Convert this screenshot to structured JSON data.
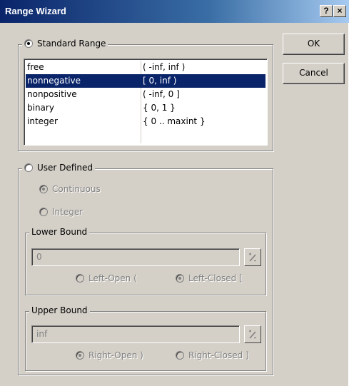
{
  "window": {
    "title": "Range Wizard",
    "help_label": "?",
    "close_label": "×"
  },
  "standard_range": {
    "label": "Standard Range",
    "selected": true,
    "items": [
      {
        "name": "free",
        "range": "( -inf, inf )",
        "selected": false
      },
      {
        "name": "nonnegative",
        "range": "[ 0, inf )",
        "selected": true
      },
      {
        "name": "nonpositive",
        "range": "( -inf, 0 ]",
        "selected": false
      },
      {
        "name": "binary",
        "range": "{ 0, 1 }",
        "selected": false
      },
      {
        "name": "integer",
        "range": "{ 0 .. maxint }",
        "selected": false
      }
    ]
  },
  "buttons": {
    "ok": "OK",
    "cancel": "Cancel"
  },
  "user_defined": {
    "label": "User Defined",
    "selected": false,
    "continuous_label": "Continuous",
    "integer_label": "Integer",
    "lower_bound": {
      "label": "Lower Bound",
      "value": "0",
      "left_open_label": "Left-Open (",
      "left_closed_label": "Left-Closed ["
    },
    "upper_bound": {
      "label": "Upper Bound",
      "value": "inf",
      "right_open_label": "Right-Open )",
      "right_closed_label": "Right-Closed ]"
    }
  },
  "icons": {
    "title_help": "help-icon",
    "title_close": "close-icon",
    "spin": "range-picker-icon"
  },
  "colors": {
    "titlebar_start": "#0a246a",
    "titlebar_end": "#a6caf0",
    "selection": "#0a246a",
    "face": "#d4d0c8"
  }
}
